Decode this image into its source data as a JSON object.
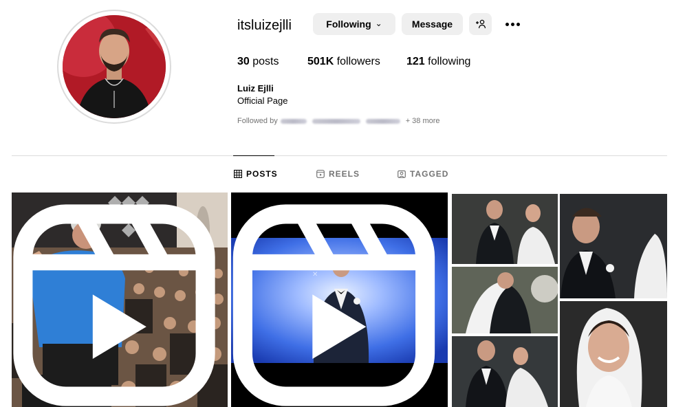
{
  "profile": {
    "username": "itsluizejlli",
    "following_label": "Following",
    "message_label": "Message",
    "full_name": "Luiz Ejlli",
    "category": "Official Page"
  },
  "stats": {
    "posts_count": "30",
    "posts_label": "posts",
    "followers_count": "501K",
    "followers_label": "followers",
    "following_count": "121",
    "following_label": "following"
  },
  "followed_by": {
    "prefix": "Followed by",
    "suffix": "+ 38 more"
  },
  "tabs": [
    {
      "label": "POSTS",
      "active": true,
      "icon": "grid-icon"
    },
    {
      "label": "REELS",
      "active": false,
      "icon": "reels-icon"
    },
    {
      "label": "TAGGED",
      "active": false,
      "icon": "tagged-icon"
    }
  ],
  "posts": [
    {
      "type": "reel",
      "icon": "reel-icon",
      "description": "concert-crowd"
    },
    {
      "type": "reel",
      "icon": "reel-icon",
      "description": "stage-performance"
    },
    {
      "type": "carousel",
      "description": "wedding-collage"
    }
  ],
  "colors": {
    "button_bg": "#efefef",
    "divider": "#dbdbdb",
    "muted_text": "#737373",
    "avatar_bg": "#a3151f",
    "stage_blue": "#3b6cf0"
  }
}
